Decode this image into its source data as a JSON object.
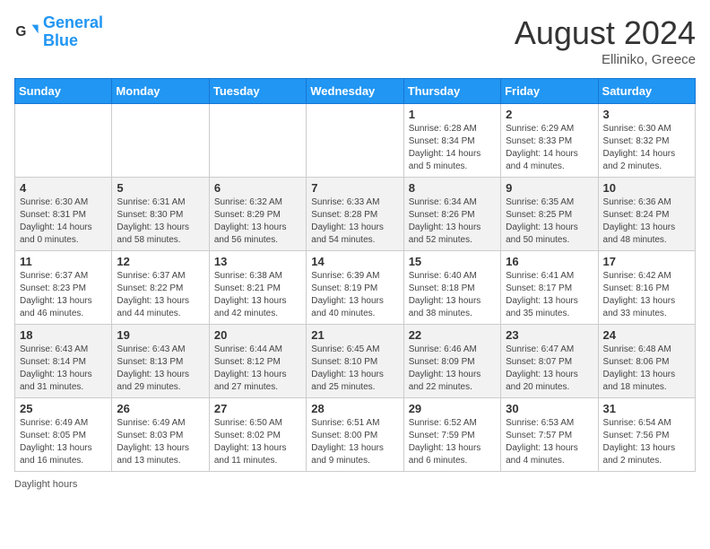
{
  "logo": {
    "line1": "General",
    "line2": "Blue"
  },
  "title": "August 2024",
  "location": "Elliniko, Greece",
  "days_header": [
    "Sunday",
    "Monday",
    "Tuesday",
    "Wednesday",
    "Thursday",
    "Friday",
    "Saturday"
  ],
  "footer_text": "Daylight hours",
  "weeks": [
    [
      {
        "day": "",
        "info": ""
      },
      {
        "day": "",
        "info": ""
      },
      {
        "day": "",
        "info": ""
      },
      {
        "day": "",
        "info": ""
      },
      {
        "day": "1",
        "info": "Sunrise: 6:28 AM\nSunset: 8:34 PM\nDaylight: 14 hours\nand 5 minutes."
      },
      {
        "day": "2",
        "info": "Sunrise: 6:29 AM\nSunset: 8:33 PM\nDaylight: 14 hours\nand 4 minutes."
      },
      {
        "day": "3",
        "info": "Sunrise: 6:30 AM\nSunset: 8:32 PM\nDaylight: 14 hours\nand 2 minutes."
      }
    ],
    [
      {
        "day": "4",
        "info": "Sunrise: 6:30 AM\nSunset: 8:31 PM\nDaylight: 14 hours\nand 0 minutes."
      },
      {
        "day": "5",
        "info": "Sunrise: 6:31 AM\nSunset: 8:30 PM\nDaylight: 13 hours\nand 58 minutes."
      },
      {
        "day": "6",
        "info": "Sunrise: 6:32 AM\nSunset: 8:29 PM\nDaylight: 13 hours\nand 56 minutes."
      },
      {
        "day": "7",
        "info": "Sunrise: 6:33 AM\nSunset: 8:28 PM\nDaylight: 13 hours\nand 54 minutes."
      },
      {
        "day": "8",
        "info": "Sunrise: 6:34 AM\nSunset: 8:26 PM\nDaylight: 13 hours\nand 52 minutes."
      },
      {
        "day": "9",
        "info": "Sunrise: 6:35 AM\nSunset: 8:25 PM\nDaylight: 13 hours\nand 50 minutes."
      },
      {
        "day": "10",
        "info": "Sunrise: 6:36 AM\nSunset: 8:24 PM\nDaylight: 13 hours\nand 48 minutes."
      }
    ],
    [
      {
        "day": "11",
        "info": "Sunrise: 6:37 AM\nSunset: 8:23 PM\nDaylight: 13 hours\nand 46 minutes."
      },
      {
        "day": "12",
        "info": "Sunrise: 6:37 AM\nSunset: 8:22 PM\nDaylight: 13 hours\nand 44 minutes."
      },
      {
        "day": "13",
        "info": "Sunrise: 6:38 AM\nSunset: 8:21 PM\nDaylight: 13 hours\nand 42 minutes."
      },
      {
        "day": "14",
        "info": "Sunrise: 6:39 AM\nSunset: 8:19 PM\nDaylight: 13 hours\nand 40 minutes."
      },
      {
        "day": "15",
        "info": "Sunrise: 6:40 AM\nSunset: 8:18 PM\nDaylight: 13 hours\nand 38 minutes."
      },
      {
        "day": "16",
        "info": "Sunrise: 6:41 AM\nSunset: 8:17 PM\nDaylight: 13 hours\nand 35 minutes."
      },
      {
        "day": "17",
        "info": "Sunrise: 6:42 AM\nSunset: 8:16 PM\nDaylight: 13 hours\nand 33 minutes."
      }
    ],
    [
      {
        "day": "18",
        "info": "Sunrise: 6:43 AM\nSunset: 8:14 PM\nDaylight: 13 hours\nand 31 minutes."
      },
      {
        "day": "19",
        "info": "Sunrise: 6:43 AM\nSunset: 8:13 PM\nDaylight: 13 hours\nand 29 minutes."
      },
      {
        "day": "20",
        "info": "Sunrise: 6:44 AM\nSunset: 8:12 PM\nDaylight: 13 hours\nand 27 minutes."
      },
      {
        "day": "21",
        "info": "Sunrise: 6:45 AM\nSunset: 8:10 PM\nDaylight: 13 hours\nand 25 minutes."
      },
      {
        "day": "22",
        "info": "Sunrise: 6:46 AM\nSunset: 8:09 PM\nDaylight: 13 hours\nand 22 minutes."
      },
      {
        "day": "23",
        "info": "Sunrise: 6:47 AM\nSunset: 8:07 PM\nDaylight: 13 hours\nand 20 minutes."
      },
      {
        "day": "24",
        "info": "Sunrise: 6:48 AM\nSunset: 8:06 PM\nDaylight: 13 hours\nand 18 minutes."
      }
    ],
    [
      {
        "day": "25",
        "info": "Sunrise: 6:49 AM\nSunset: 8:05 PM\nDaylight: 13 hours\nand 16 minutes."
      },
      {
        "day": "26",
        "info": "Sunrise: 6:49 AM\nSunset: 8:03 PM\nDaylight: 13 hours\nand 13 minutes."
      },
      {
        "day": "27",
        "info": "Sunrise: 6:50 AM\nSunset: 8:02 PM\nDaylight: 13 hours\nand 11 minutes."
      },
      {
        "day": "28",
        "info": "Sunrise: 6:51 AM\nSunset: 8:00 PM\nDaylight: 13 hours\nand 9 minutes."
      },
      {
        "day": "29",
        "info": "Sunrise: 6:52 AM\nSunset: 7:59 PM\nDaylight: 13 hours\nand 6 minutes."
      },
      {
        "day": "30",
        "info": "Sunrise: 6:53 AM\nSunset: 7:57 PM\nDaylight: 13 hours\nand 4 minutes."
      },
      {
        "day": "31",
        "info": "Sunrise: 6:54 AM\nSunset: 7:56 PM\nDaylight: 13 hours\nand 2 minutes."
      }
    ]
  ]
}
